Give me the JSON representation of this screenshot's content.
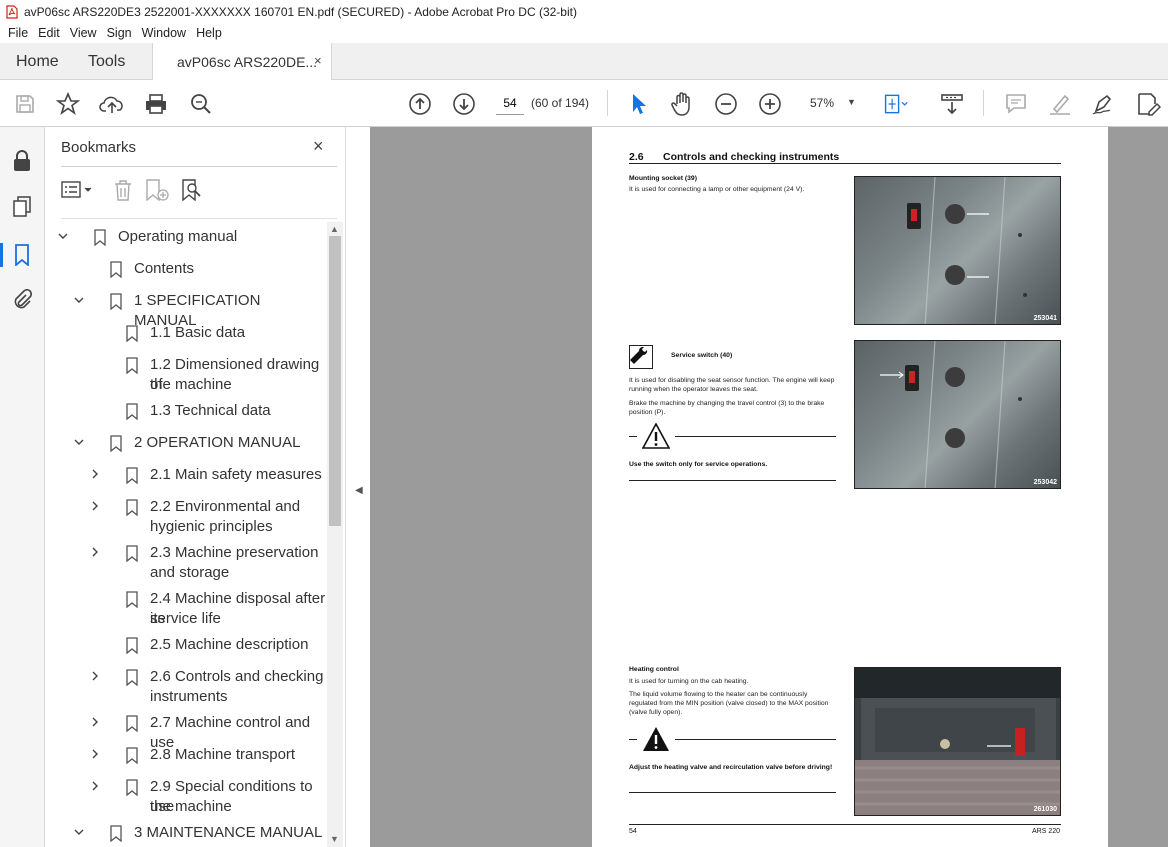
{
  "window": {
    "title": "avP06sc ARS220DE3 2522001-XXXXXXX 160701 EN.pdf (SECURED) - Adobe Acrobat Pro DC (32-bit)"
  },
  "menu": [
    "File",
    "Edit",
    "View",
    "Sign",
    "Window",
    "Help"
  ],
  "tabs": {
    "home": "Home",
    "tools": "Tools",
    "document": "avP06sc ARS220DE...",
    "close": "×"
  },
  "toolbar": {
    "page_current": "54",
    "page_count": "(60 of 194)",
    "zoom": "57%"
  },
  "bookmarks": {
    "title": "Bookmarks",
    "close": "×",
    "items": [
      {
        "label": "Operating manual"
      },
      {
        "label": "Contents"
      },
      {
        "label": "1 SPECIFICATION MANUAL"
      },
      {
        "label": "1.1 Basic data"
      },
      {
        "label": "1.2 Dimensioned drawing of",
        "label2": "the machine"
      },
      {
        "label": "1.3 Technical data"
      },
      {
        "label": "2 OPERATION MANUAL"
      },
      {
        "label": "2.1 Main safety measures"
      },
      {
        "label": "2.2 Environmental and",
        "label2": "hygienic principles"
      },
      {
        "label": "2.3 Machine preservation",
        "label2": "and storage"
      },
      {
        "label": "2.4 Machine disposal after its",
        "label2": "service life"
      },
      {
        "label": "2.5 Machine description"
      },
      {
        "label": "2.6 Controls and checking",
        "label2": "instruments"
      },
      {
        "label": "2.7 Machine control and use"
      },
      {
        "label": "2.8 Machine transport"
      },
      {
        "label": "2.9 Special conditions to use",
        "label2": "the machine"
      },
      {
        "label": "3 MAINTENANCE MANUAL"
      }
    ]
  },
  "page": {
    "section_number": "2.6",
    "section_title": "Controls and checking instruments",
    "block1": {
      "heading": "Mounting socket (39)",
      "text": "It is used for connecting a lamp or other equipment (24 V).",
      "photo_id": "253041"
    },
    "block2": {
      "heading": "Service switch (40)",
      "text1": "It is used for disabling the seat sensor function. The engine will keep running when the operator leaves the seat.",
      "text2": "Brake the machine by changing the travel control (3) to the brake position (P).",
      "warning": "Use the switch only for service operations.",
      "photo_id": "253042"
    },
    "block3": {
      "heading": "Heating control",
      "text1": "It is used for turning on the cab heating.",
      "text2": "The liquid volume flowing to the heater can be continuously regulated from the MIN position (valve closed) to the MAX position (valve fully open).",
      "warning": "Adjust the heating valve and recirculation valve before driving!",
      "photo_id": "261030"
    },
    "footer_page": "54",
    "footer_model": "ARS 220"
  }
}
